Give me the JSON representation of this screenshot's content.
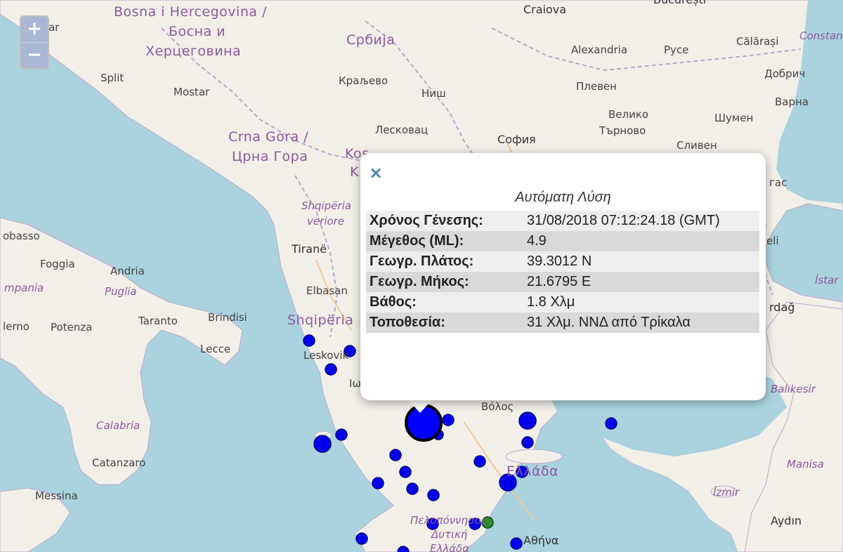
{
  "map": {
    "zoom_in_label": "+",
    "zoom_out_label": "−",
    "labels": {
      "bosna_1": "Bosna i Hercegovina /",
      "bosna_2": "Босна и",
      "bosna_3": "Херцеговина",
      "zadar": "Zadar",
      "split": "Split",
      "mostar": "Mostar",
      "srbija": "Србија",
      "kraljevo": "Краљево",
      "nis": "Ниш",
      "leskovac": "Лесковац",
      "crna_gora_1": "Crna Gora /",
      "crna_gora_2": "Црна Гора",
      "kosovo_1": "Kos",
      "kosovo_2": "K",
      "craiova": "Craiova",
      "bucuresti": "București",
      "constanta": "Constan",
      "alexandria": "Alexandria",
      "ruse": "Русе",
      "calarasi": "Călărași",
      "dobrich": "Добрич",
      "pleven": "Плевен",
      "varna": "Варна",
      "veliko_1": "Велико",
      "veliko_2": "Търново",
      "shumen": "Шумен",
      "sofia": "София",
      "sliven": "Сливен",
      "burgas": "гас",
      "shqiperia_veriore_1": "Shqipëria",
      "shqiperia_veriore_2": "veriore",
      "tirane": "Tiranë",
      "elbasan": "Elbasan",
      "shqiperia": "Shqipëria",
      "leskovik": "Leskovik",
      "ioannina": "Ιω",
      "edirne": "eli",
      "istanbul": "İstar",
      "tekirdag": "rdağ",
      "balikesir": "Balıkesir",
      "manisa": "Manisa",
      "izmir": "İzmir",
      "aydin": "Aydın",
      "volos": "Βόλος",
      "ellada": "Ελλάδα",
      "peloponnisos": "Πελοπόννησος",
      "dytiki_1": "Δυτική",
      "dytiki_2": "Ελλάδα",
      "athina": "Αθήνα",
      "obasso": "obasso",
      "foggia": "Foggia",
      "andria": "Andria",
      "puglia": "Puglia",
      "campania": "mpania",
      "brindisi": "Brindisi",
      "taranto": "Taranto",
      "salerno": "lerno",
      "potenza": "Potenza",
      "lecce": "Lecce",
      "calabria": "Calabria",
      "catanzaro": "Catanzaro",
      "messina": "Messina"
    },
    "markers": {
      "selected_color": "#0000ff",
      "other_color": "#0000ee",
      "green_color": "#2e8b2e"
    }
  },
  "popup": {
    "close_label": "×",
    "title": "Αυτόματη Λύση",
    "rows": [
      {
        "key": "Χρόνος Γένεσης:",
        "value": "31/08/2018 07:12:24.18 (GMT)"
      },
      {
        "key": "Μέγεθος (ML):",
        "value": "4.9"
      },
      {
        "key": "Γεωγρ. Πλάτος:",
        "value": "39.3012 N"
      },
      {
        "key": "Γεωγρ. Μήκος:",
        "value": "21.6795 E"
      },
      {
        "key": "Βάθος:",
        "value": "1.8 Χλμ"
      },
      {
        "key": "Τοποθεσία:",
        "value": "31 Χλμ. ΝΝΔ από Τρίκαλα"
      }
    ]
  }
}
